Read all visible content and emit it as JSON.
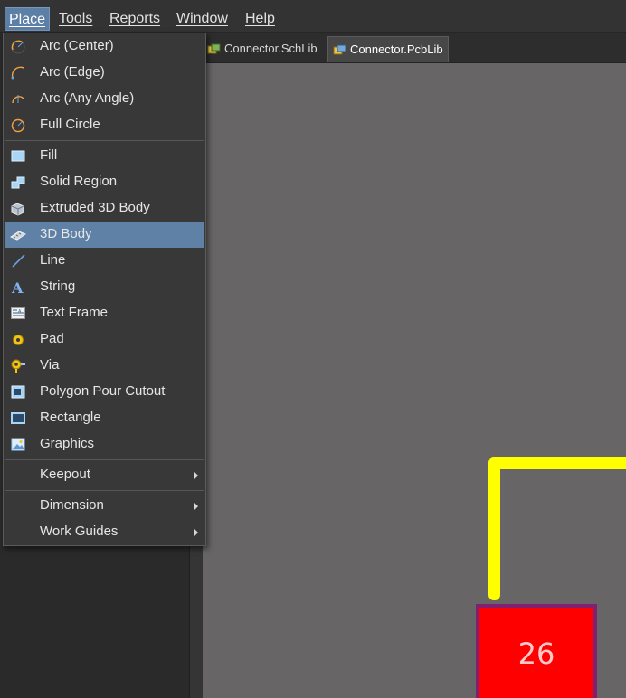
{
  "menubar": {
    "items": [
      {
        "label": "Place",
        "active": true
      },
      {
        "label": "Tools"
      },
      {
        "label": "Reports"
      },
      {
        "label": "Window"
      },
      {
        "label": "Help"
      }
    ]
  },
  "tabs": [
    {
      "label": "Connector.SchLib",
      "icon": "schlib-doc-icon"
    },
    {
      "label": "Connector.PcbLib",
      "icon": "pcblib-doc-icon",
      "active": true
    }
  ],
  "place_menu": {
    "groups": [
      [
        {
          "label": "Arc (Center)",
          "icon": "arc-center-icon"
        },
        {
          "label": "Arc (Edge)",
          "icon": "arc-edge-icon"
        },
        {
          "label": "Arc (Any Angle)",
          "icon": "arc-any-angle-icon"
        },
        {
          "label": "Full Circle",
          "icon": "full-circle-icon"
        }
      ],
      [
        {
          "label": "Fill",
          "icon": "fill-icon"
        },
        {
          "label": "Solid Region",
          "icon": "solid-region-icon"
        },
        {
          "label": "Extruded 3D Body",
          "icon": "extruded-3d-body-icon"
        },
        {
          "label": "3D Body",
          "icon": "3d-body-icon",
          "highlighted": true
        },
        {
          "label": "Line",
          "icon": "line-icon"
        },
        {
          "label": "String",
          "icon": "string-icon"
        },
        {
          "label": "Text Frame",
          "icon": "text-frame-icon"
        },
        {
          "label": "Pad",
          "icon": "pad-icon"
        },
        {
          "label": "Via",
          "icon": "via-icon"
        },
        {
          "label": "Polygon Pour Cutout",
          "icon": "polygon-pour-cutout-icon"
        },
        {
          "label": "Rectangle",
          "icon": "rectangle-icon"
        },
        {
          "label": "Graphics",
          "icon": "graphics-icon"
        }
      ],
      [
        {
          "label": "Keepout",
          "submenu": true
        }
      ],
      [
        {
          "label": "Dimension",
          "submenu": true
        },
        {
          "label": "Work Guides",
          "submenu": true
        }
      ]
    ]
  },
  "canvas": {
    "pad_designator": "26",
    "colors": {
      "background": "#676565",
      "track": "#ffff00",
      "pad_fill": "#ff0000",
      "pad_outline": "#80206e",
      "menu_highlight": "#5f81a6"
    }
  }
}
